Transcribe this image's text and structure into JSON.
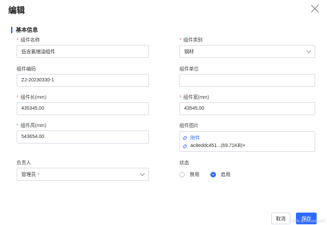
{
  "dialog": {
    "title": "编辑",
    "section_title": "基本信息"
  },
  "form": {
    "name": {
      "label": "组件名称",
      "required": "*",
      "value": "低含氯缩油组件"
    },
    "category": {
      "label": "组件类别",
      "required": "*",
      "value": "钢材"
    },
    "code": {
      "label": "组件编码",
      "value": "ZJ-20230330-1"
    },
    "unit": {
      "label": "组件单位",
      "value": ""
    },
    "length": {
      "label": "组件长(mm)",
      "required": "*",
      "value": "435345.00"
    },
    "width": {
      "label": "组件宽(mm)",
      "required": "*",
      "value": "43545.00"
    },
    "height": {
      "label": "组件高(mm)",
      "required": "*",
      "value": "543654.00"
    },
    "image": {
      "label": "组件图片",
      "upload_link": "附件",
      "file_name": "ac8eddc451...(69.71KB)",
      "file_remove": "×"
    },
    "owner": {
      "label": "负责人",
      "tag": "管理员",
      "tag_remove": "×"
    },
    "status": {
      "label": "状态",
      "options": [
        "禁用",
        "启用"
      ],
      "selected": "启用"
    }
  },
  "footer": {
    "cancel_label": "取消",
    "save_label": "保存",
    "watermark": "CSDN @Ghostclone22"
  },
  "colors": {
    "accent": "#2f6bff",
    "required": "#f04848"
  }
}
